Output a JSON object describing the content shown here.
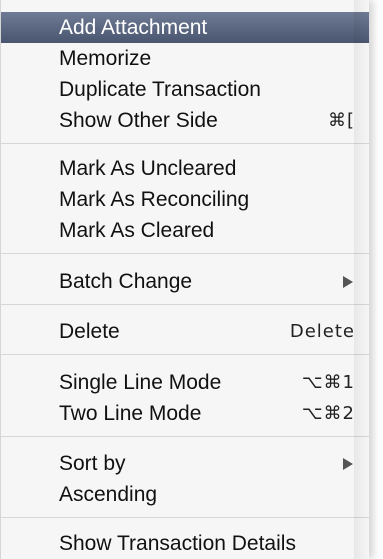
{
  "menu": {
    "items": [
      {
        "label": "Add Attachment",
        "shortcut": "",
        "submenu": false,
        "selected": true
      },
      {
        "label": "Memorize",
        "shortcut": "",
        "submenu": false,
        "selected": false
      },
      {
        "label": "Duplicate Transaction",
        "shortcut": "",
        "submenu": false,
        "selected": false
      },
      {
        "label": "Show Other Side",
        "shortcut": "⌘[",
        "submenu": false,
        "selected": false
      },
      {
        "label": "Mark As Uncleared",
        "shortcut": "",
        "submenu": false,
        "selected": false
      },
      {
        "label": "Mark As Reconciling",
        "shortcut": "",
        "submenu": false,
        "selected": false
      },
      {
        "label": "Mark As Cleared",
        "shortcut": "",
        "submenu": false,
        "selected": false
      },
      {
        "label": "Batch Change",
        "shortcut": "",
        "submenu": true,
        "selected": false
      },
      {
        "label": "Delete",
        "shortcut": "Delete",
        "submenu": false,
        "selected": false
      },
      {
        "label": "Single Line Mode",
        "shortcut": "⌥⌘1",
        "submenu": false,
        "selected": false
      },
      {
        "label": "Two Line Mode",
        "shortcut": "⌥⌘2",
        "submenu": false,
        "selected": false
      },
      {
        "label": "Sort by",
        "shortcut": "",
        "submenu": true,
        "selected": false
      },
      {
        "label": "Ascending",
        "shortcut": "",
        "submenu": false,
        "selected": false
      },
      {
        "label": "Show Transaction Details",
        "shortcut": "",
        "submenu": false,
        "selected": false
      }
    ]
  },
  "colors": {
    "selected_background": "#56627c",
    "menu_background": "#f6f6f6",
    "divider": "#d7d7d7"
  }
}
